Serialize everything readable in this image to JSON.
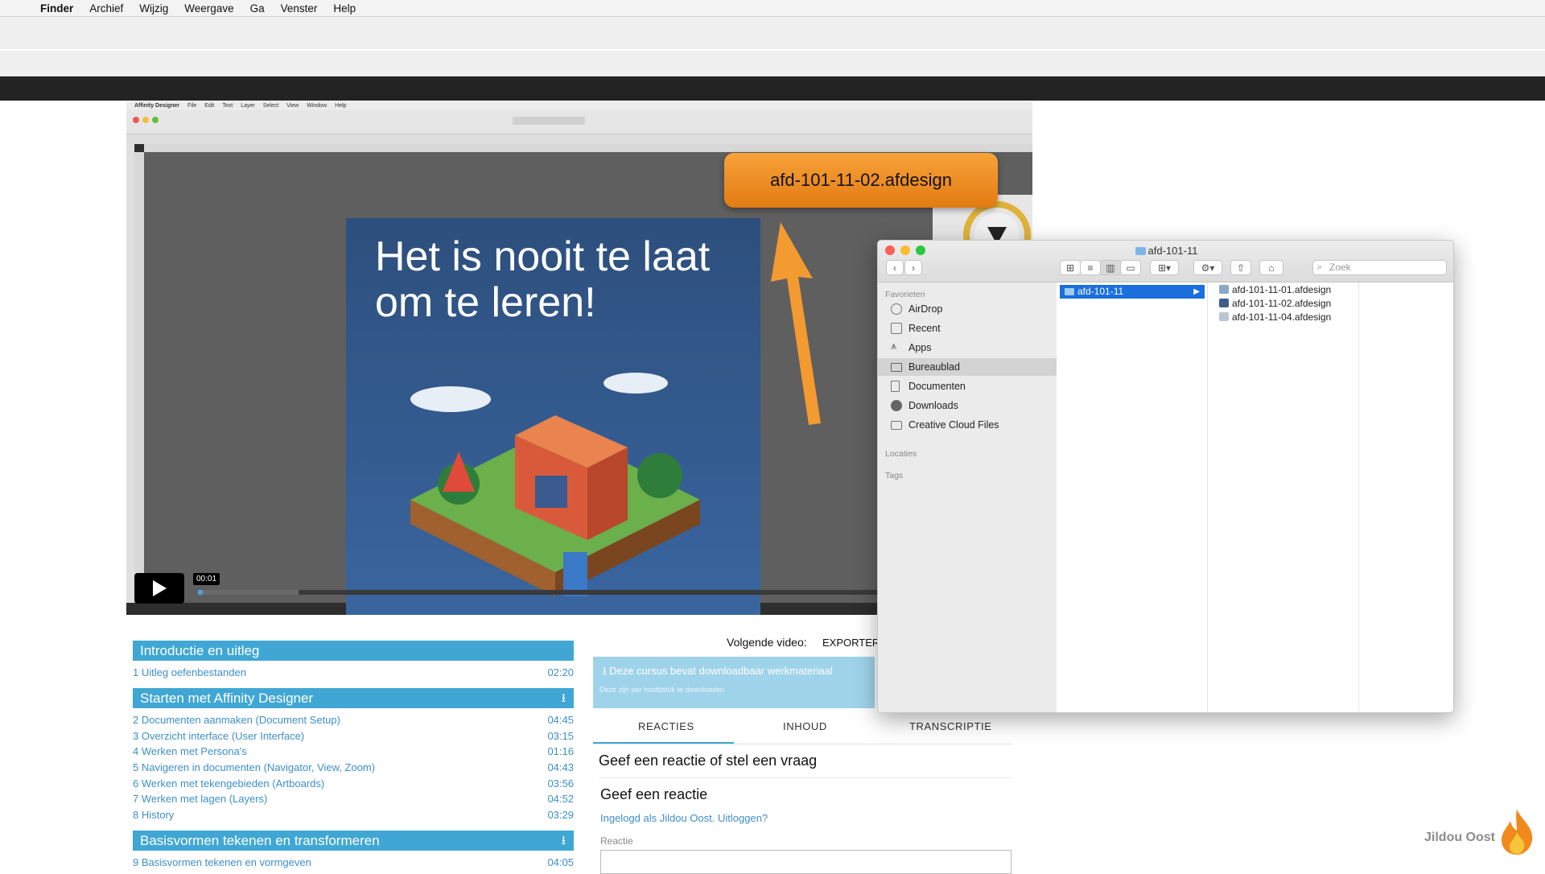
{
  "menubar": {
    "app": "Finder",
    "items": [
      "Archief",
      "Wijzig",
      "Weergave",
      "Ga",
      "Venster",
      "Help"
    ]
  },
  "video": {
    "affinity_menubar": [
      "Affinity Designer",
      "File",
      "Edit",
      "Text",
      "Layer",
      "Select",
      "View",
      "Window",
      "Help"
    ],
    "artboard_title": "Het is nooit te laat om te leren!",
    "callout_filename": "afd-101-11-02.afdesign",
    "current_time": "00:01",
    "buffered_fraction": 0.12,
    "played_fraction": 0.006
  },
  "course": {
    "sections": [
      {
        "title": "Introductie en uitleg",
        "has_download": false,
        "lessons": [
          {
            "title": "1 Uitleg oefenbestanden",
            "duration": "02:20"
          }
        ]
      },
      {
        "title": "Starten met Affinity Designer",
        "has_download": true,
        "lessons": [
          {
            "title": "2 Documenten aanmaken (Document Setup)",
            "duration": "04:45"
          },
          {
            "title": "3 Overzicht interface (User Interface)",
            "duration": "03:15"
          },
          {
            "title": "4 Werken met Persona's",
            "duration": "01:16"
          },
          {
            "title": "5 Navigeren in documenten (Navigator, View, Zoom)",
            "duration": "04:43"
          },
          {
            "title": "6 Werken met tekengebieden (Artboards)",
            "duration": "03:56"
          },
          {
            "title": "7 Werken met lagen (Layers)",
            "duration": "04:52"
          },
          {
            "title": "8 History",
            "duration": "03:29"
          }
        ]
      },
      {
        "title": "Basisvormen tekenen en transformeren",
        "has_download": true,
        "lessons": [
          {
            "title": "9 Basisvormen tekenen en vormgeven",
            "duration": "04:05"
          }
        ]
      }
    ]
  },
  "content": {
    "next_label": "Volgende video:",
    "next_title": "EXPORTERE",
    "download_title": "Deze cursus bevat downloadbaar werkmateriaal",
    "download_sub": "Deze zijn per hoofdstuk te downloaden",
    "tabs": [
      "REACTIES",
      "INHOUD",
      "TRANSCRIPTIE"
    ],
    "question_title": "Geef een reactie of stel een vraag",
    "reply_title": "Geef een reactie",
    "login_text": "Ingelogd als Jildou Oost.",
    "logout_text": "Uitloggen?",
    "reactie_label": "Reactie"
  },
  "finder": {
    "title": "afd-101-11",
    "search_placeholder": "Zoek",
    "sidebar": {
      "favorites_head": "Favorieten",
      "favorites": [
        {
          "label": "AirDrop",
          "icon": "airdrop-icon"
        },
        {
          "label": "Recent",
          "icon": "recent-icon"
        },
        {
          "label": "Apps",
          "icon": "apps-icon"
        },
        {
          "label": "Bureaublad",
          "icon": "desktop-icon",
          "selected": true
        },
        {
          "label": "Documenten",
          "icon": "documents-icon"
        },
        {
          "label": "Downloads",
          "icon": "downloads-icon"
        },
        {
          "label": "Creative Cloud Files",
          "icon": "folder-icon"
        }
      ],
      "locations_head": "Locaties",
      "tags_head": "Tags"
    },
    "column1_selected": "afd-101-11",
    "files": [
      "afd-101-11-01.afdesign",
      "afd-101-11-02.afdesign",
      "afd-101-11-04.afdesign"
    ]
  },
  "watermark": "Jildou Oost",
  "colors": {
    "accent": "#40a7d4",
    "callout_orange": "#f39a30",
    "finder_selection": "#1a6fdc"
  }
}
